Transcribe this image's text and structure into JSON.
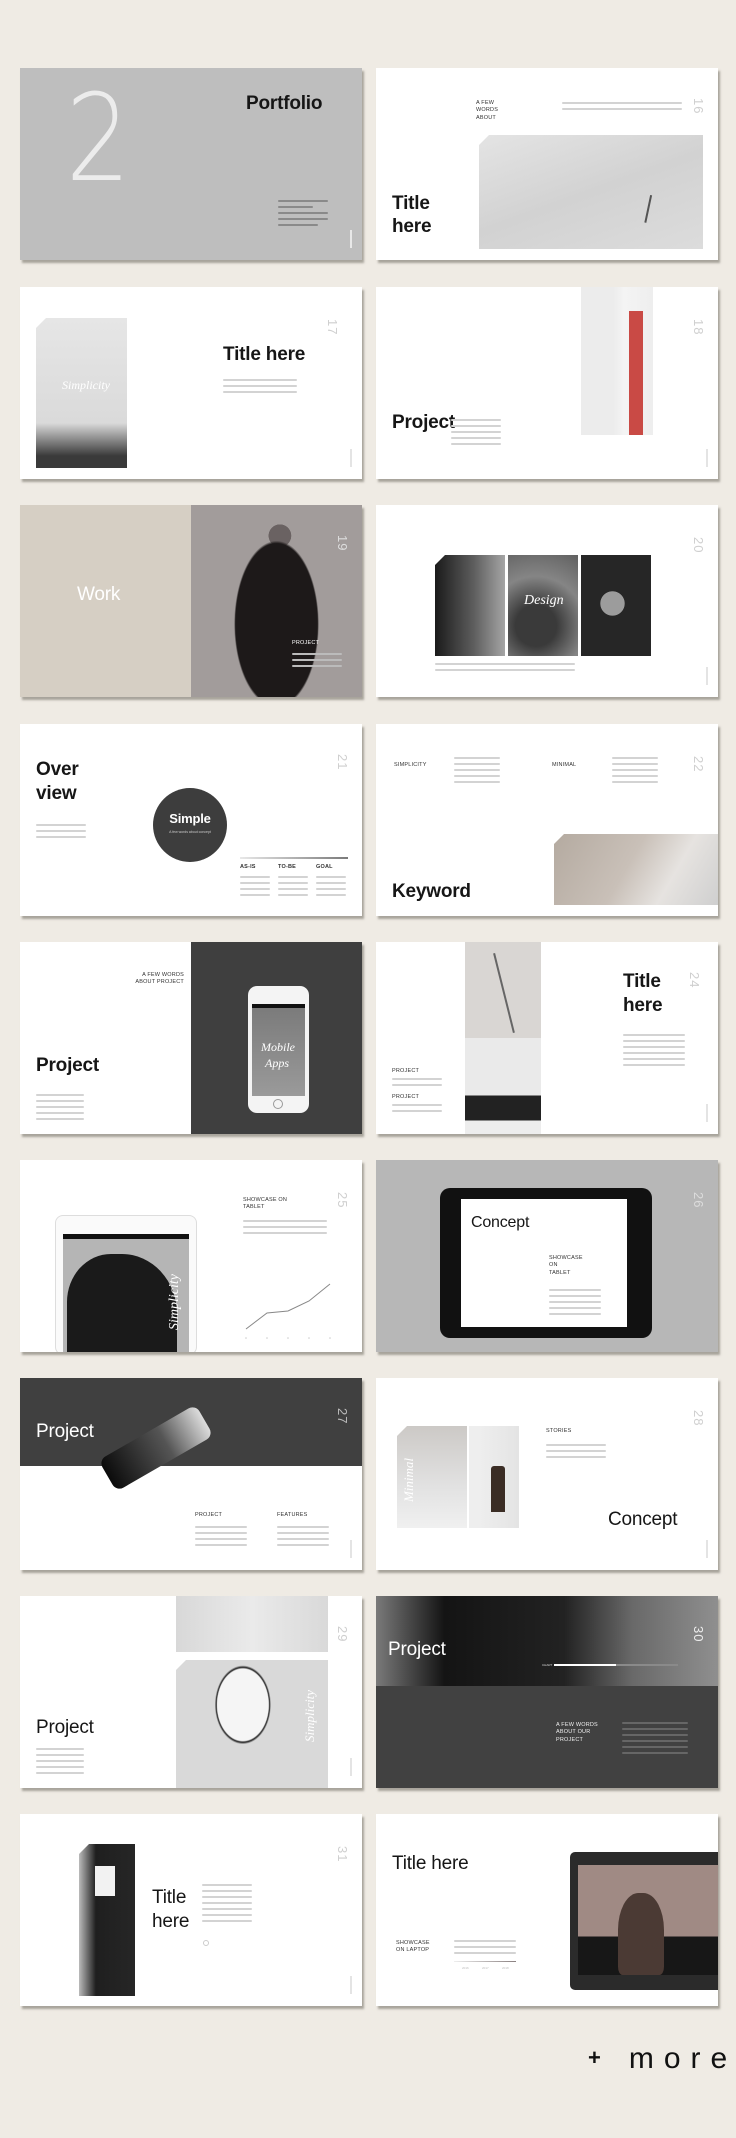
{
  "page": {
    "more_label": "more",
    "plus_symbol": "+"
  },
  "slides": {
    "s2": {
      "number": "2",
      "title": "Portfolio"
    },
    "s16": {
      "number": "16",
      "label": "A FEW WORDS ABOUT",
      "title_line1": "Title",
      "title_line2": "here"
    },
    "s17": {
      "number": "17",
      "title": "Title here",
      "overlay": "Simplicity"
    },
    "s18": {
      "number": "18",
      "title": "Project"
    },
    "s19": {
      "number": "19",
      "title": "Work",
      "label": "PROJECT"
    },
    "s20": {
      "number": "20",
      "overlay": "Design"
    },
    "s21": {
      "number": "21",
      "title_line1": "Over",
      "title_line2": "view",
      "circle_title": "Simple",
      "circle_sub": "A few words about concept",
      "columns": [
        "AS-IS",
        "TO-BE",
        "GOAL"
      ]
    },
    "s22": {
      "number": "22",
      "labels": [
        "SIMPLICITY",
        "MINIMAL"
      ],
      "title": "Keyword"
    },
    "s23": {
      "label": "A FEW WORDS ABOUT PROJECT",
      "title": "Project",
      "phone_text_1": "Mobile",
      "phone_text_2": "Apps"
    },
    "s24": {
      "number": "24",
      "labels": [
        "PROJECT",
        "PROJECT"
      ],
      "title_line1": "Title",
      "title_line2": "here"
    },
    "s25": {
      "number": "25",
      "label": "SHOWCASE ON TABLET",
      "overlay": "Simplicity",
      "chart_values": [
        10,
        42,
        46,
        66,
        100
      ]
    },
    "s26": {
      "number": "26",
      "title": "Concept",
      "label": "SHOWCASE ON TABLET"
    },
    "s27": {
      "number": "27",
      "title": "Project",
      "columns": [
        "PROJECT",
        "FEATURES"
      ]
    },
    "s28": {
      "number": "28",
      "label": "STORIES",
      "overlay": "Minimal",
      "title": "Concept"
    },
    "s29": {
      "number": "29",
      "title": "Project",
      "overlay": "Simplicity"
    },
    "s30": {
      "number": "30",
      "title": "Project",
      "label": "A FEW WORDS ABOUT OUR PROJECT",
      "bar_label": "CHART",
      "bar_fill": 0.5
    },
    "s31": {
      "number": "31",
      "title_line1": "Title",
      "title_line2": "here"
    },
    "s32": {
      "title": "Title here",
      "label": "SHOWCASE ON LAPTOP",
      "scale_labels": [
        "2016",
        "2017",
        "2018"
      ]
    }
  }
}
